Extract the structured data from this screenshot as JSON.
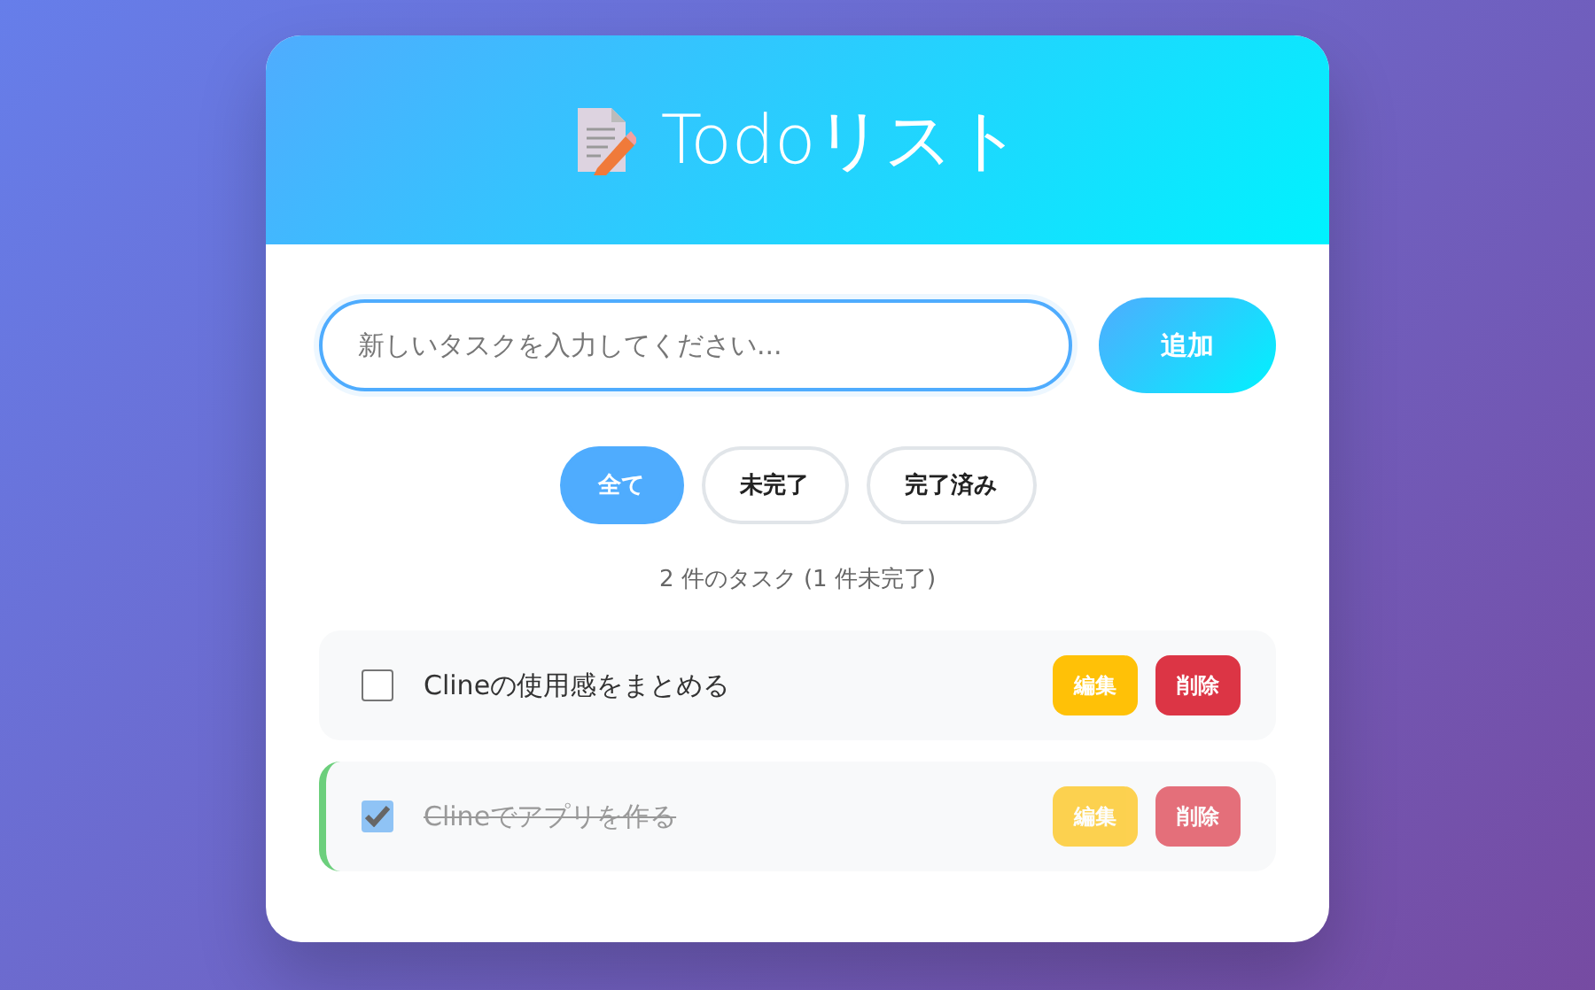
{
  "header": {
    "title": "Todoリスト"
  },
  "new_task": {
    "placeholder": "新しいタスクを入力してください...",
    "add_button": "追加"
  },
  "filters": [
    {
      "label": "全て",
      "selected": true
    },
    {
      "label": "未完了",
      "selected": false
    },
    {
      "label": "完了済み",
      "selected": false
    }
  ],
  "summary": "2 件のタスク (1 件未完了)",
  "tasks": [
    {
      "text": "Clineの使用感をまとめる",
      "completed": false,
      "edit_label": "編集",
      "delete_label": "削除"
    },
    {
      "text": "Clineでアプリを作る",
      "completed": true,
      "edit_label": "編集",
      "delete_label": "削除"
    }
  ]
}
